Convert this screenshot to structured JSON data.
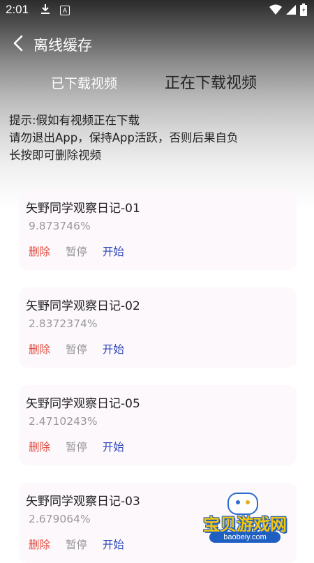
{
  "status_bar": {
    "time": "2:01",
    "download_icon": "download-icon",
    "app_icon_letter": "A",
    "wifi_icon": "wifi-icon",
    "signal_icon": "signal-icon",
    "battery_icon": "battery-icon"
  },
  "header": {
    "back_icon": "chevron-left-icon",
    "title": "离线缓存"
  },
  "tabs": [
    {
      "label": "已下载视频",
      "active": false
    },
    {
      "label": "正在下载视频",
      "active": true
    }
  ],
  "notice": {
    "line1": "提示:假如有视频正在下载",
    "line2": "请勿退出App，保持App活跃，否则后果自负",
    "line3": "长按即可删除视频"
  },
  "downloads": [
    {
      "name": "矢野同学观察日记-01",
      "progress": "9.873746%",
      "delete": "删除",
      "pause": "暂停",
      "start": "开始"
    },
    {
      "name": "矢野同学观察日记-02",
      "progress": "2.8372374%",
      "delete": "删除",
      "pause": "暂停",
      "start": "开始"
    },
    {
      "name": "矢野同学观察日记-05",
      "progress": "2.4710243%",
      "delete": "删除",
      "pause": "暂停",
      "start": "开始"
    },
    {
      "name": "矢野同学观察日记-03",
      "progress": "2.679064%",
      "delete": "删除",
      "pause": "暂停",
      "start": "开始"
    }
  ],
  "watermark": {
    "text": "宝贝游戏网",
    "url": "baobeiy.com"
  },
  "colors": {
    "delete": "#e04b3f",
    "pause": "#999999",
    "start": "#2c46b8",
    "card_bg": "#fdf8fc"
  }
}
